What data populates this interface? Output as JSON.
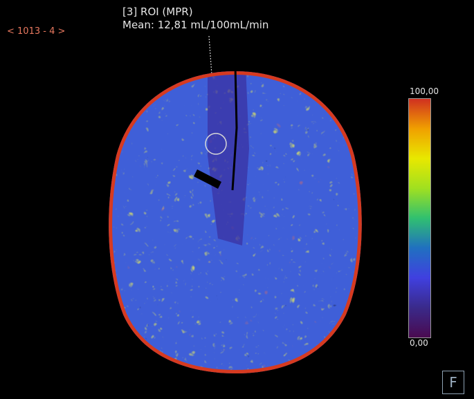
{
  "viewer": {
    "slice_nav": "< 1013 - 4 >",
    "roi_title": "[3] ROI (MPR)",
    "roi_mean": "Mean: 12,81 mL/100mL/min"
  },
  "colorbar": {
    "max_label": "100,00",
    "min_label": "0,00",
    "stops": [
      "#d03020",
      "#f0a000",
      "#e8e800",
      "#a0e020",
      "#30c070",
      "#2070c0",
      "#4040e0",
      "#3a2a8a",
      "#4a0a50"
    ]
  },
  "orientation_marker": {
    "label": "F"
  },
  "colors": {
    "background": "#000000",
    "nav_text": "#e8785f",
    "overlay_text": "#e6e6e6"
  }
}
